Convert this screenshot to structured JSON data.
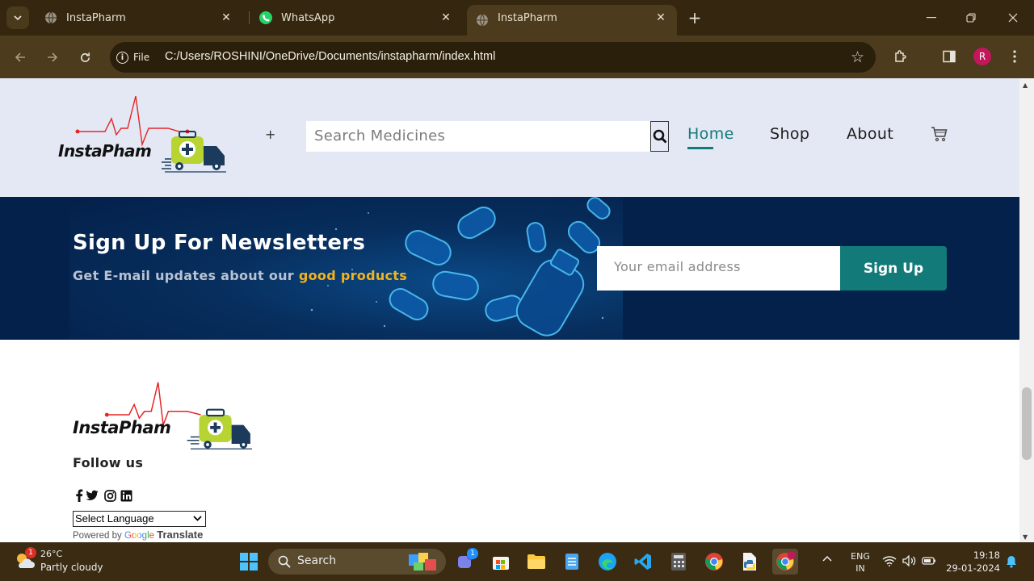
{
  "browser": {
    "tabs": [
      {
        "title": "InstaPharm",
        "active": false
      },
      {
        "title": "WhatsApp",
        "active": false
      },
      {
        "title": "InstaPharm",
        "active": true
      }
    ],
    "file_chip": "File",
    "url": "C:/Users/ROSHINI/OneDrive/Documents/instapharm/index.html",
    "profile_initial": "R"
  },
  "header": {
    "logo_text": "InstaPham",
    "plus": "+",
    "search_placeholder": "Search Medicines",
    "nav": [
      {
        "label": "Home",
        "active": true
      },
      {
        "label": "Shop",
        "active": false
      },
      {
        "label": "About",
        "active": false
      }
    ]
  },
  "newsletter": {
    "title": "Sign Up For Newsletters",
    "subtitle_prefix": "Get E-mail updates about our ",
    "subtitle_highlight": "good products",
    "email_placeholder": "Your email address",
    "button": "Sign Up"
  },
  "footer": {
    "logo_text": "InstaPham",
    "follow_us": "Follow us",
    "social": [
      "facebook-icon",
      "twitter-icon",
      "instagram-icon",
      "linkedin-icon"
    ],
    "language_select": "Select Language",
    "powered_by": "Powered by",
    "google": "Google",
    "translate": "Translate"
  },
  "taskbar": {
    "weather_badge": "1",
    "temperature": "26°C",
    "condition": "Partly cloudy",
    "search_label": "Search",
    "teams_badge": "1",
    "lang_line1": "ENG",
    "lang_line2": "IN",
    "time": "19:18",
    "date": "29-01-2024"
  },
  "colors": {
    "accent": "#137a7a",
    "highlight": "#f3b320",
    "header_bg": "#e4e8f4",
    "newsletter_bg": "#03214a",
    "chrome_bg": "#35270f"
  }
}
